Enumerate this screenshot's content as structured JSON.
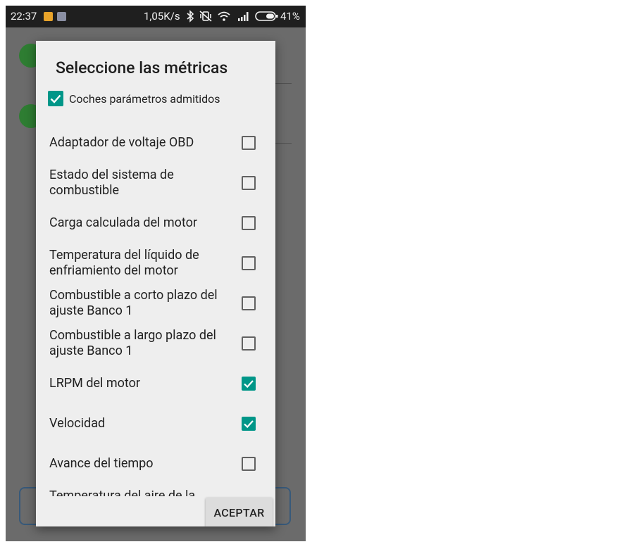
{
  "status_bar": {
    "time": "22:37",
    "network_speed": "1,05K/s",
    "battery_percent": "41%",
    "icons": [
      "app-notification-icon",
      "shield-notification-icon",
      "bluetooth-icon",
      "vibrate-icon",
      "wifi-icon",
      "signal-icon",
      "battery-icon"
    ]
  },
  "dialog": {
    "title": "Seleccione las métricas",
    "select_all": {
      "label": "Coches parámetros admitidos",
      "checked": true
    },
    "items": [
      {
        "label": "Adaptador de voltaje OBD",
        "checked": false
      },
      {
        "label": "Estado del sistema de combustible",
        "checked": false
      },
      {
        "label": "Carga calculada del motor",
        "checked": false
      },
      {
        "label": "Temperatura del líquido de enfriamiento del motor",
        "checked": false
      },
      {
        "label": "Combustible a corto plazo del ajuste Banco 1",
        "checked": false
      },
      {
        "label": "Combustible a largo plazo del ajuste Banco 1",
        "checked": false
      },
      {
        "label": "LRPM del motor",
        "checked": true
      },
      {
        "label": "Velocidad",
        "checked": true
      },
      {
        "label": "Avance del tiempo",
        "checked": false
      },
      {
        "label": "Temperatura del aire de la admisión",
        "checked": false
      }
    ],
    "accept_label": "ACEPTAR"
  },
  "colors": {
    "accent": "#009688",
    "background_check": "#2e7d32",
    "scrim": "#6b6b6b"
  }
}
